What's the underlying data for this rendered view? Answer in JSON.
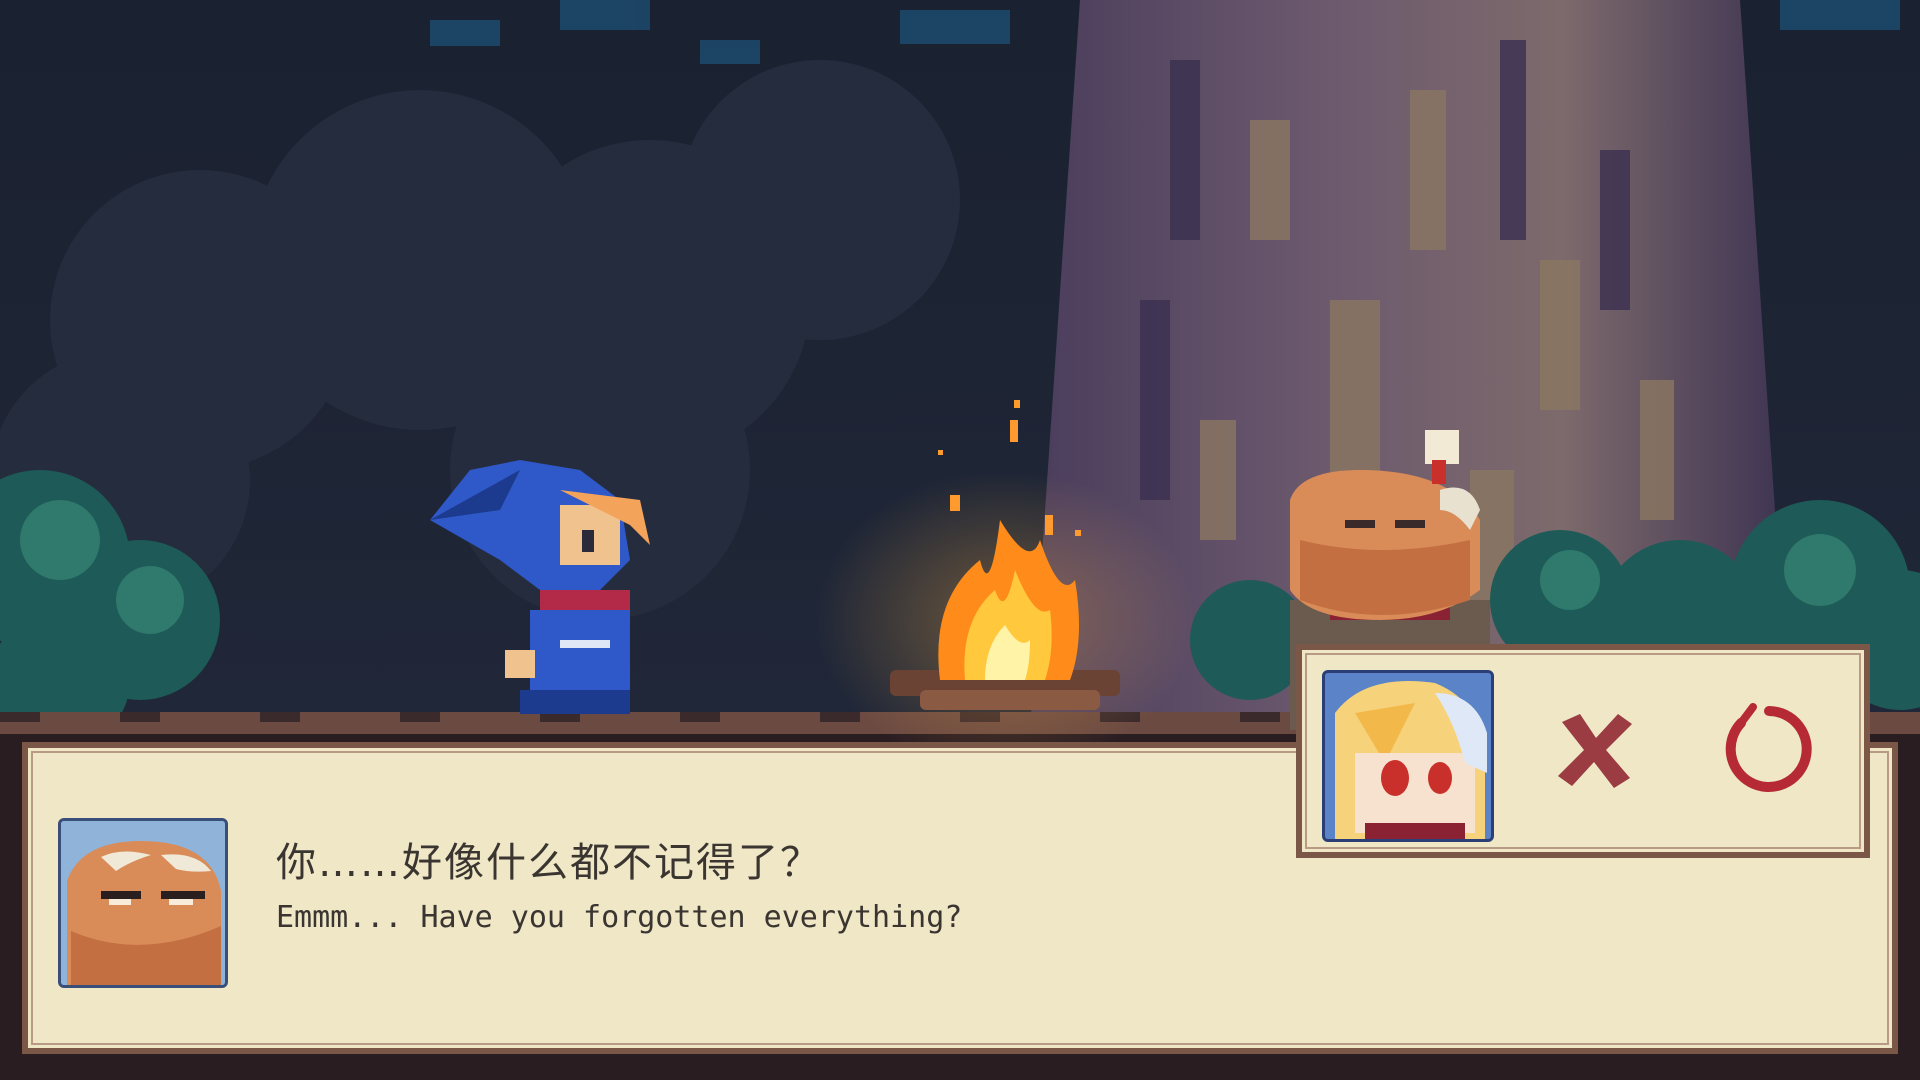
{
  "scene": {
    "characters": [
      "ninja-girl",
      "old-man"
    ],
    "props": [
      "campfire",
      "great-tree"
    ]
  },
  "dialog": {
    "line_cn": "你……好像什么都不记得了？",
    "line_en": "Emmm... Have you forgotten everything?",
    "speaker_portrait": "old-man-portrait-icon"
  },
  "choice": {
    "portrait": "blonde-girl-portrait-icon",
    "cancel_icon": "cross-icon",
    "confirm_icon": "circle-icon"
  },
  "colors": {
    "panel_bg": "#efe7c6",
    "panel_border": "#7a5747",
    "accent_red": "#b52a34",
    "cross": "#9b3b42"
  }
}
